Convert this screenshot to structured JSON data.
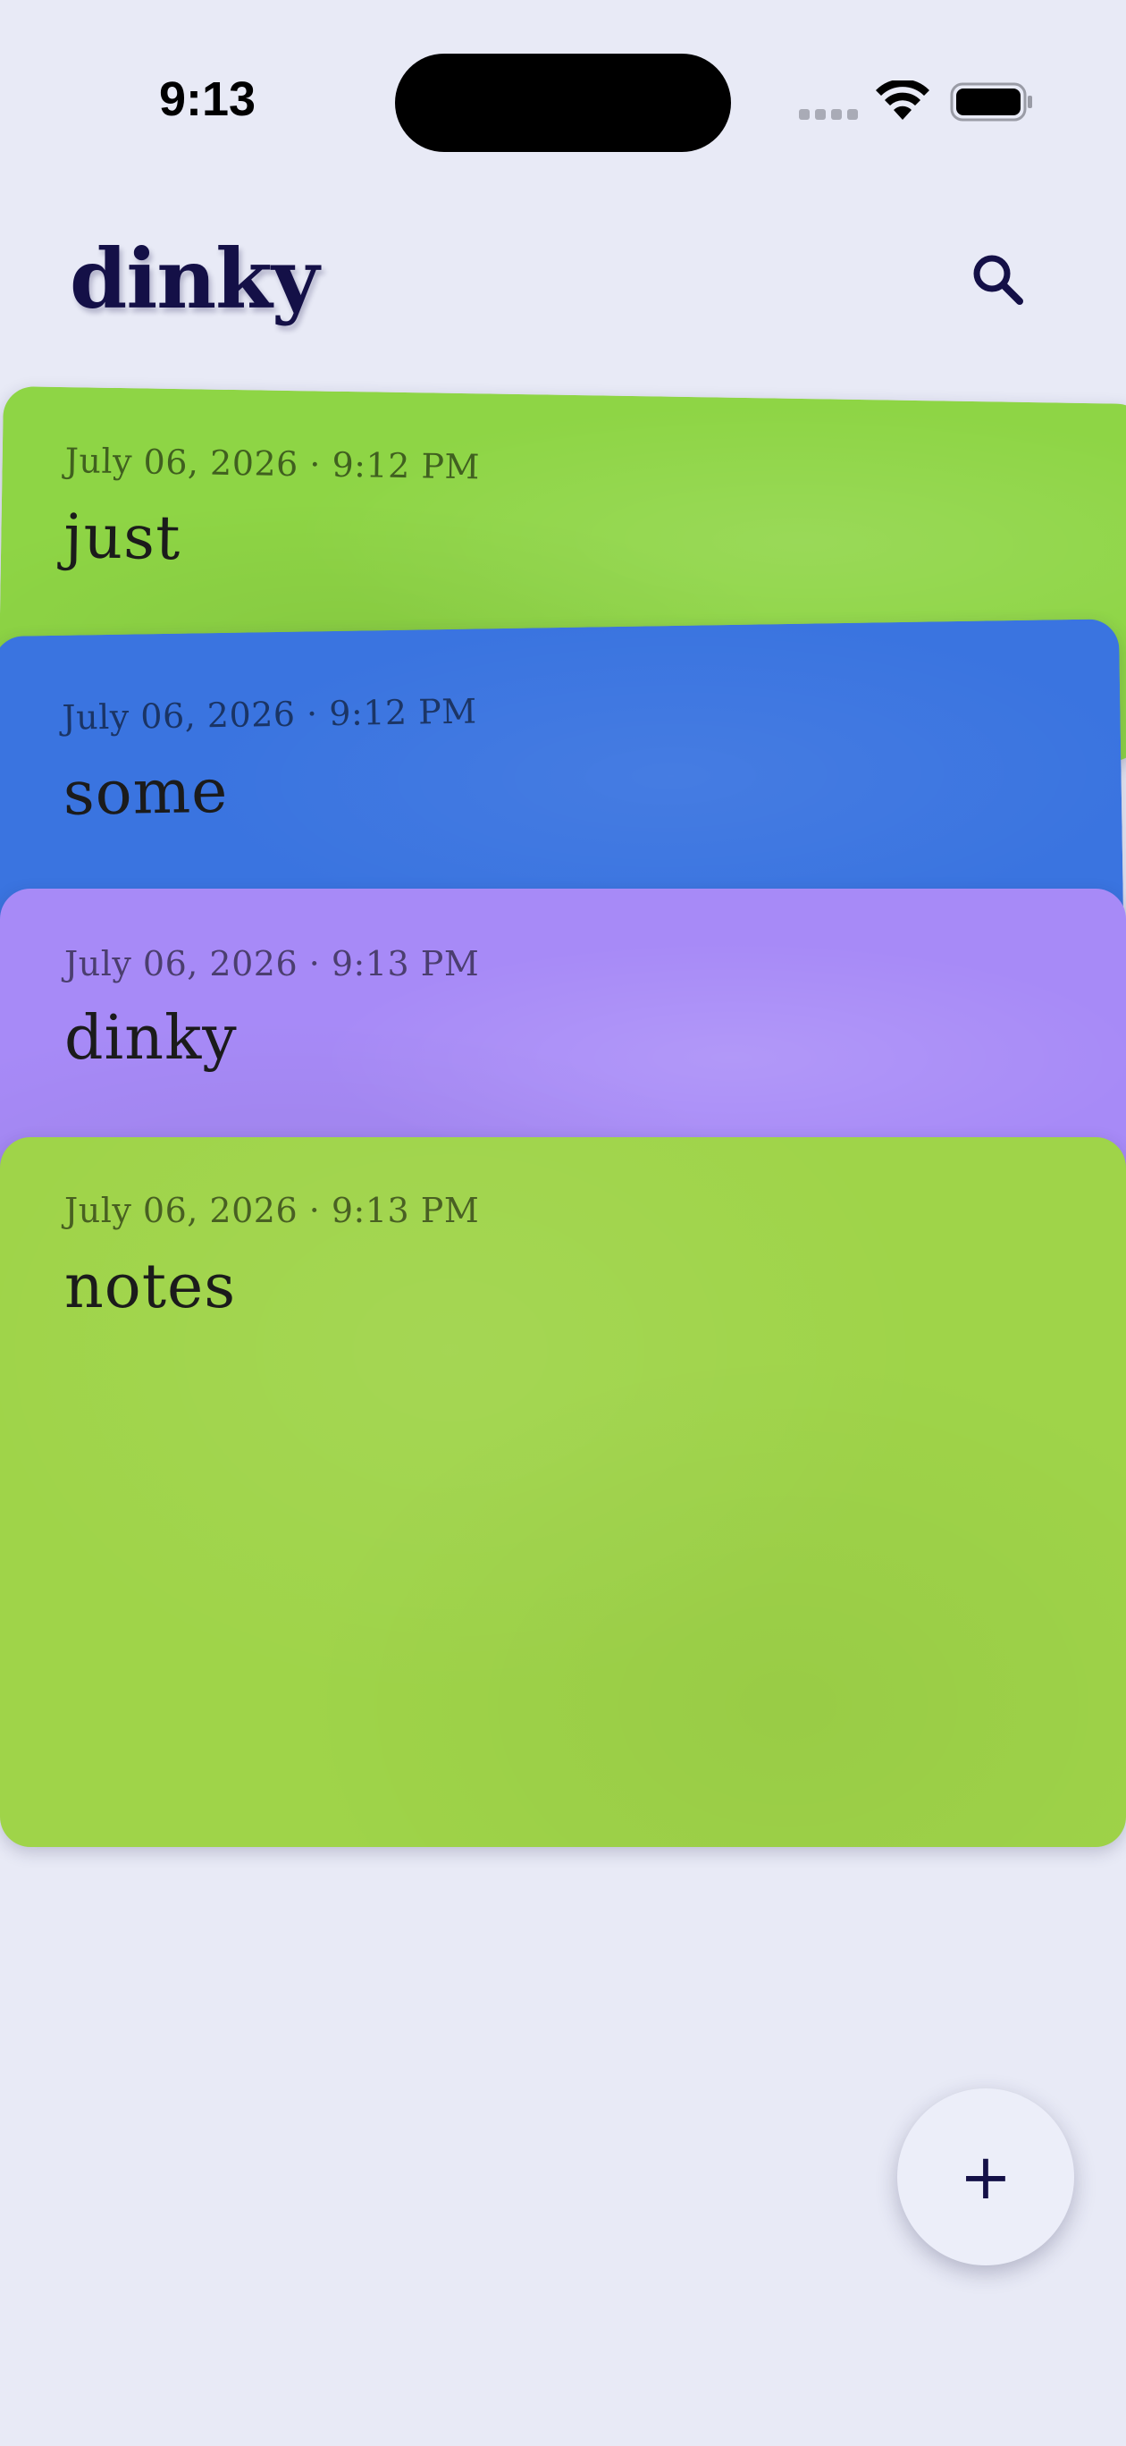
{
  "status_bar": {
    "time": "9:13"
  },
  "header": {
    "title": "dinky"
  },
  "notes": [
    {
      "date": "July 06, 2026 · 9:12 PM",
      "title": "just",
      "color": "#8ed545"
    },
    {
      "date": "July 06, 2026 · 9:12 PM",
      "title": "some",
      "color": "#3a74e0"
    },
    {
      "date": "July 06, 2026 · 9:13 PM",
      "title": "dinky",
      "color": "#a78af7"
    },
    {
      "date": "July 06, 2026 · 9:13 PM",
      "title": "notes",
      "color": "#9fd449"
    }
  ],
  "fab": {
    "icon": "plus-icon",
    "symbol": "+"
  },
  "colors": {
    "background": "#e8eaf6",
    "accent": "#141047"
  }
}
